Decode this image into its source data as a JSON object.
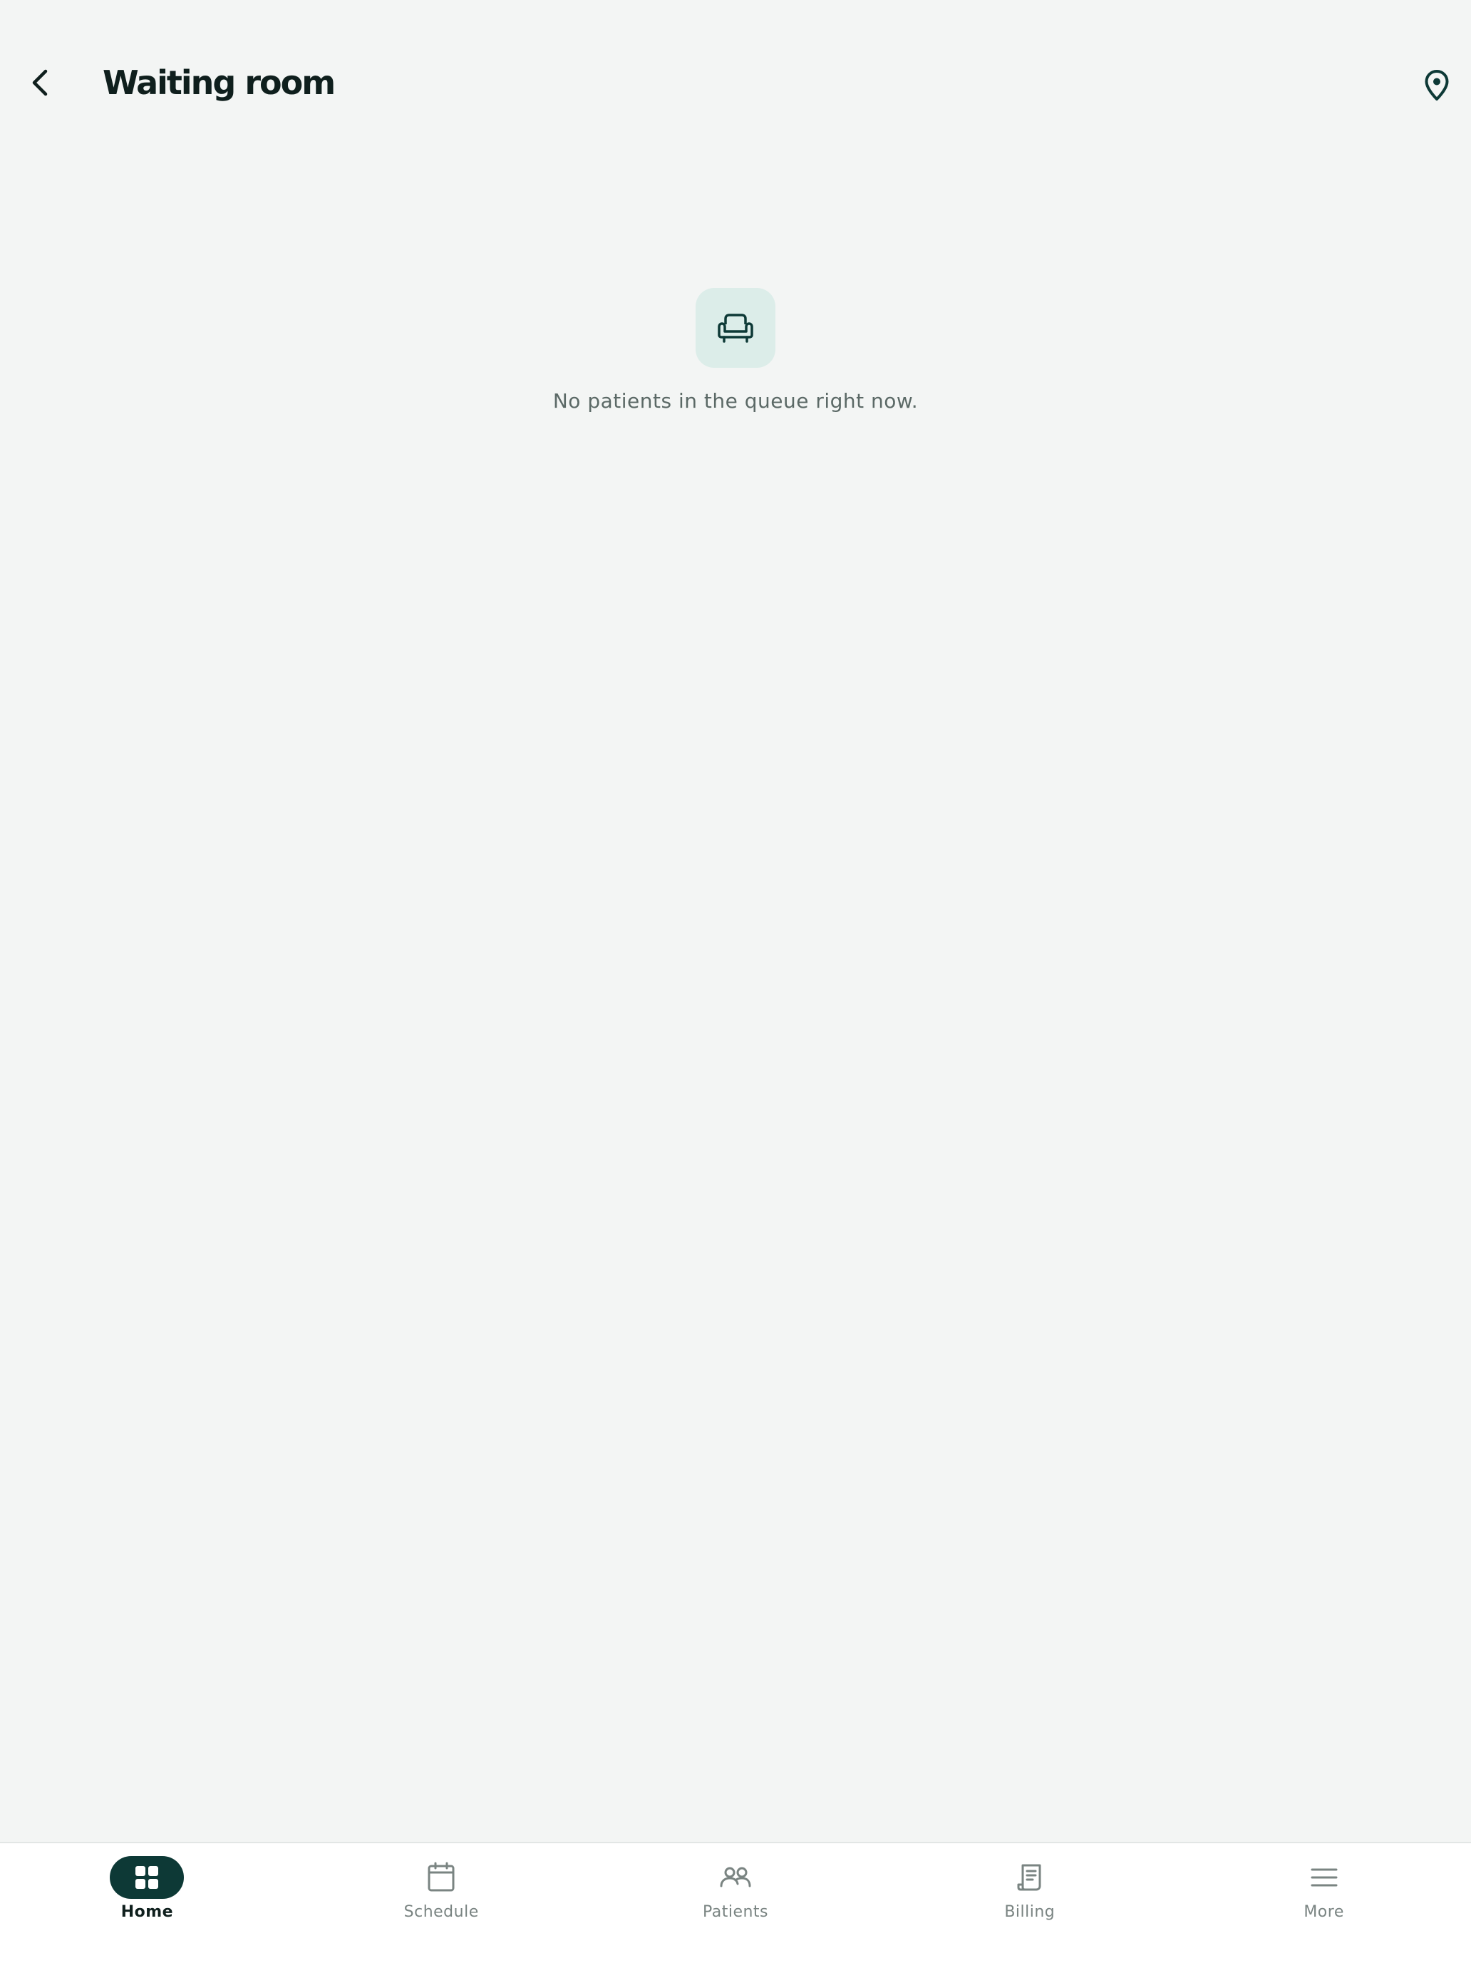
{
  "header": {
    "title": "Waiting room",
    "back_icon": "chevron-left-icon",
    "location_icon": "map-pin-icon"
  },
  "empty_state": {
    "icon": "armchair-icon",
    "message": "No patients in the queue right now."
  },
  "bottom_nav": {
    "items": [
      {
        "label": "Home",
        "icon": "grid-icon",
        "active": true
      },
      {
        "label": "Schedule",
        "icon": "calendar-icon",
        "active": false
      },
      {
        "label": "Patients",
        "icon": "people-icon",
        "active": false
      },
      {
        "label": "Billing",
        "icon": "receipt-icon",
        "active": false
      },
      {
        "label": "More",
        "icon": "menu-icon",
        "active": false
      }
    ]
  },
  "colors": {
    "background": "#f3f5f4",
    "accent": "#0d3936",
    "icon_tile": "#dcede9",
    "text_primary": "#0f1f1d",
    "text_muted": "#5b6966"
  }
}
